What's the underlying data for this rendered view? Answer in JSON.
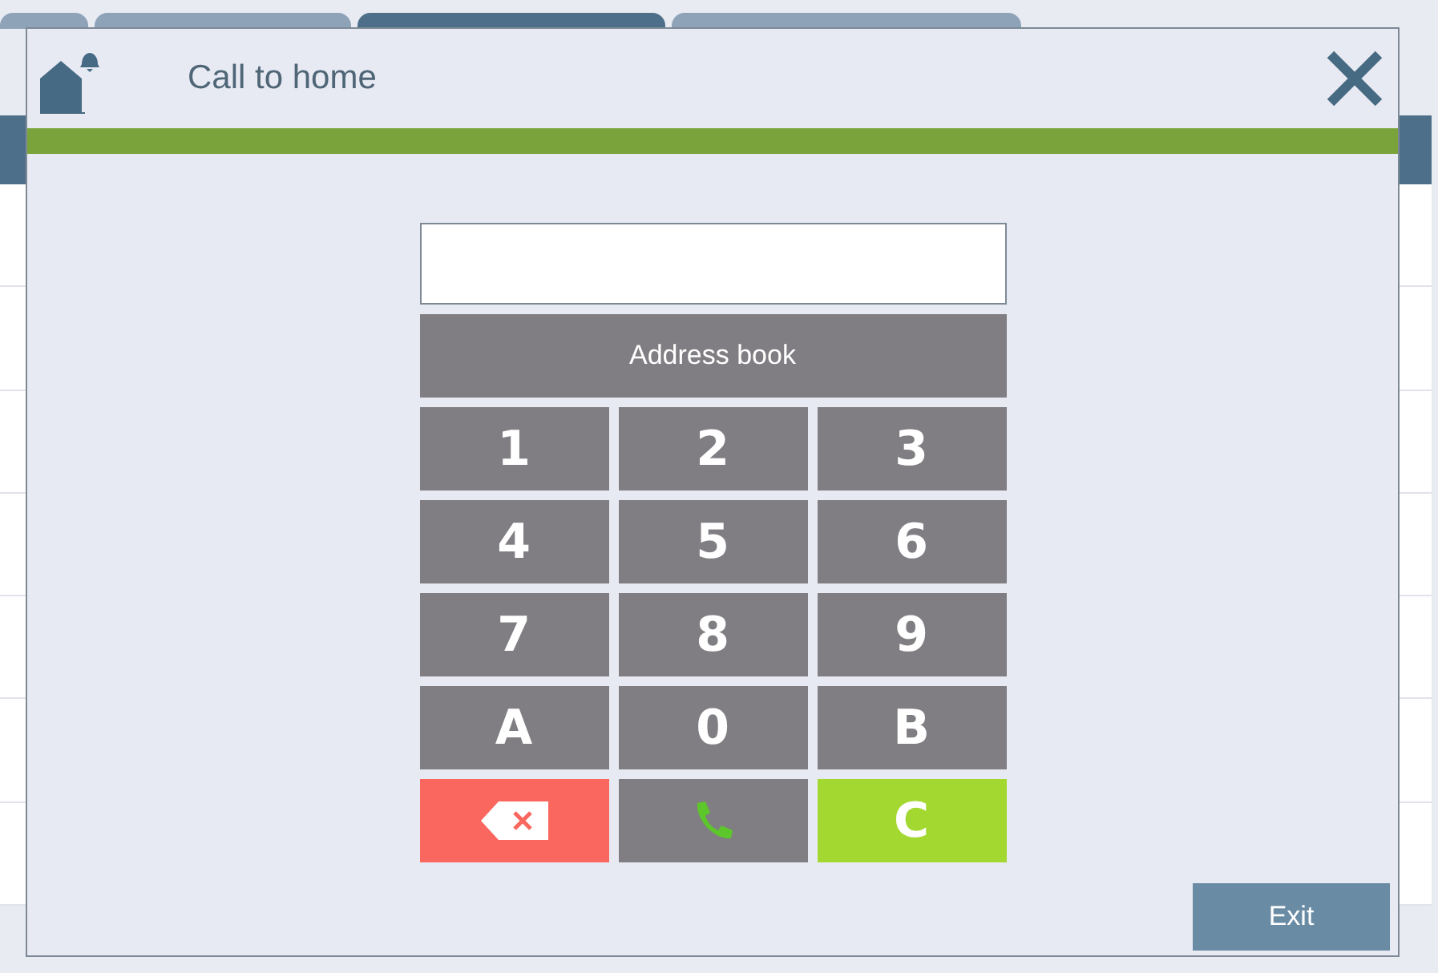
{
  "window": {
    "title": "Call to home"
  },
  "background_tabs": [
    {
      "selected": false
    },
    {
      "selected": false
    },
    {
      "selected": true
    },
    {
      "selected": false
    }
  ],
  "address_book_button": "Address book",
  "keys": [
    {
      "kind": "digit",
      "label": "1"
    },
    {
      "kind": "digit",
      "label": "2"
    },
    {
      "kind": "digit",
      "label": "3"
    },
    {
      "kind": "digit",
      "label": "4"
    },
    {
      "kind": "digit",
      "label": "5"
    },
    {
      "kind": "digit",
      "label": "6"
    },
    {
      "kind": "digit",
      "label": "7"
    },
    {
      "kind": "digit",
      "label": "8"
    },
    {
      "kind": "digit",
      "label": "9"
    },
    {
      "kind": "digit",
      "label": "A"
    },
    {
      "kind": "digit",
      "label": "0"
    },
    {
      "kind": "digit",
      "label": "B"
    },
    {
      "kind": "backspace"
    },
    {
      "kind": "call"
    },
    {
      "kind": "clear",
      "label": "C"
    }
  ],
  "exit_button": "Exit"
}
